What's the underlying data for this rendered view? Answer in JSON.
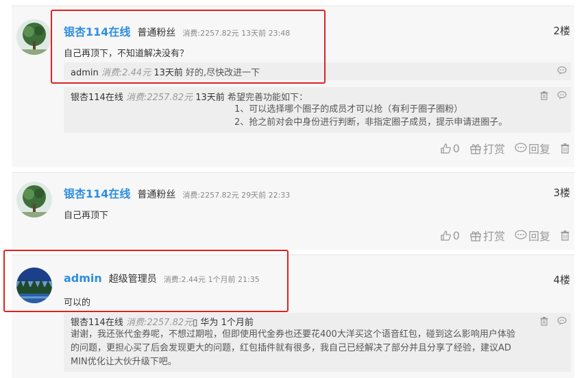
{
  "posts": [
    {
      "user": "银杏114在线",
      "role": "普通粉丝",
      "meta": "消费:2257.82元 13天前 23:48",
      "floor": "2楼",
      "content": "自己再顶下，不知道解决没有？",
      "replies": [
        {
          "user": "admin",
          "cost": "消费:2.44元",
          "time": "13天前",
          "text": "好的,尽快改进一下"
        },
        {
          "user": "银杏114在线",
          "cost": "消费:2257.82元",
          "time": "13天前",
          "text": "希望完善功能如下：",
          "lines": [
            "1、可以选择哪个圈子的成员才可以抢（有利于圈子圈粉）",
            "2、抢之前对会中身份进行判断，非指定圈子成员，提示申请进圈子。"
          ]
        }
      ],
      "likes": "0"
    },
    {
      "user": "银杏114在线",
      "role": "普通粉丝",
      "meta": "消费:2257.82元 29天前 22:33",
      "floor": "3楼",
      "content": "自己再顶下",
      "likes": "0"
    },
    {
      "user": "admin",
      "role": "超级管理员",
      "meta": "消费:2.44元 1个月前 21:35",
      "floor": "4楼",
      "content": "可以的",
      "replies": [
        {
          "user": "银杏114在线",
          "cost": "消费:2257.82元",
          "badge": "▯",
          "brand": "华为",
          "time": "1个月前",
          "lines": [
            "谢谢，我还张代金券呢，不想过期啦，但即使用代金券也还要花400大洋买这个语音红包，碰到这么影响用户体验",
            "的问题，更担心买了后会发现更大的问题，红包插件就有很多，我自己已经解决了部分并且分享了经验，建议AD",
            "MIN优化让大伙升级下吧。"
          ]
        }
      ]
    }
  ],
  "actions": {
    "reward": "打赏",
    "reply": "回复"
  },
  "colors": {
    "username": "#2d8ee0",
    "highlight": "#e02020",
    "muted": "#999999"
  }
}
